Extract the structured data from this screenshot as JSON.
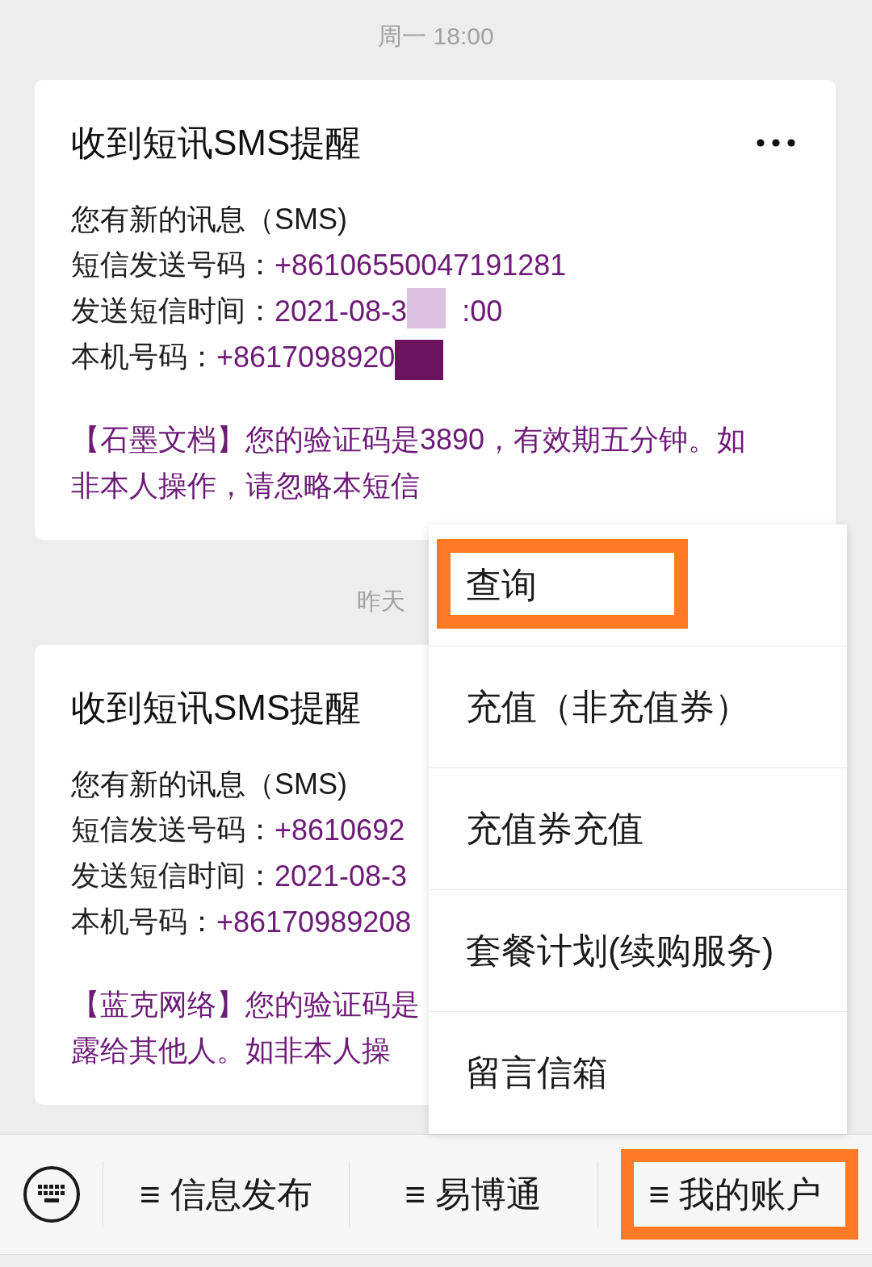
{
  "messages": [
    {
      "time": "周一 18:00",
      "time_cut": false,
      "card": {
        "title": "收到短讯SMS提醒",
        "more_menu": true,
        "heading": "您有新的讯息（SMS)",
        "fields": [
          {
            "label": "短信发送号码：",
            "value": "+86106550047191281"
          },
          {
            "label": "发送短信时间：",
            "value": "2021-08-3",
            "redaction": {
              "color": "#dcc0e1"
            },
            "value_after": ":00"
          },
          {
            "label": "本机号码：",
            "value": "+8617098920",
            "redaction": {
              "color": "#6a145f"
            }
          }
        ],
        "message": "【石墨文档】您的验证码是3890，有效期五分钟。如非本人操作，请忽略本短信"
      }
    },
    {
      "time": "昨天",
      "time_cut": true,
      "card": {
        "title": "收到短讯SMS提醒",
        "more_menu": false,
        "heading": "您有新的讯息（SMS)",
        "fields": [
          {
            "label": "短信发送号码：",
            "value": "+8610692"
          },
          {
            "label": "发送短信时间：",
            "value": "2021-08-3"
          },
          {
            "label": "本机号码：",
            "value": "+86170989208"
          }
        ],
        "message_lines": [
          "【蓝克网络】您的验证码是",
          "露给其他人。如非本人操"
        ]
      }
    }
  ],
  "popup_menu": {
    "items": [
      {
        "label": "查询",
        "highlighted": true
      },
      {
        "label": "充值（非充值券）",
        "highlighted": false
      },
      {
        "label": "充值券充值",
        "highlighted": false
      },
      {
        "label": "套餐计划(续购服务)",
        "highlighted": false
      },
      {
        "label": "留言信箱",
        "highlighted": false
      }
    ]
  },
  "bottom_menu": {
    "items": [
      {
        "icon": "≡",
        "label": "信息发布",
        "highlighted": false
      },
      {
        "icon": "≡",
        "label": "易博通",
        "highlighted": false
      },
      {
        "icon": "≡",
        "label": "我的账户",
        "highlighted": true
      }
    ]
  }
}
